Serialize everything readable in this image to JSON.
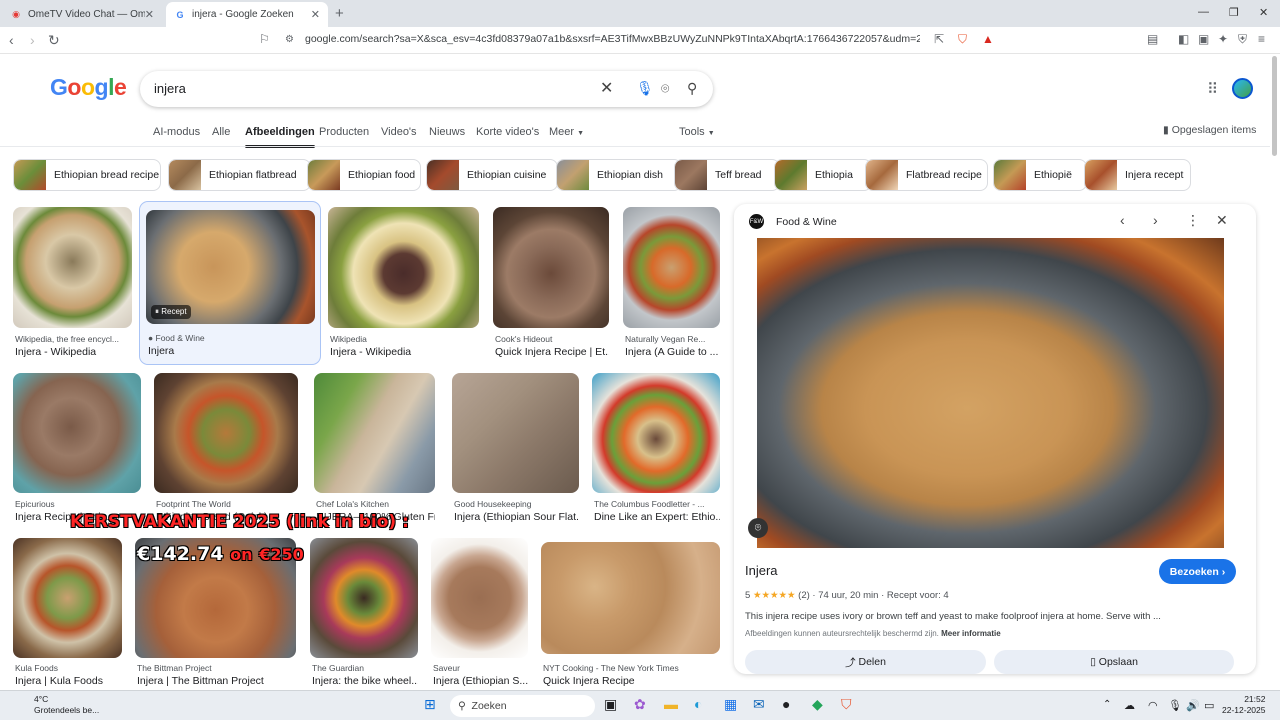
{
  "browser": {
    "tabs": [
      {
        "title": "OmeTV Video Chat — Omegle R",
        "active": false
      },
      {
        "title": "injera - Google Zoeken",
        "active": true
      }
    ],
    "url": "google.com/search?sa=X&sca_esv=4c3fd08379a07a1b&sxsrf=AE3TifMwxBBzUWyZuNNPk9TIntaXAbqrtA:1766436722057&udm=2&fbs=AIIjpHzoN..."
  },
  "google": {
    "logo": "Google",
    "query": "injera",
    "tabs": [
      "AI-modus",
      "Alle",
      "Afbeeldingen",
      "Producten",
      "Video's",
      "Nieuws",
      "Korte video's",
      "Meer",
      "Tools"
    ],
    "selected_tab": "Afbeeldingen",
    "saved_label": "Opgeslagen items"
  },
  "chips": [
    "Ethiopian bread recipe",
    "Ethiopian flatbread",
    "Ethiopian food",
    "Ethiopian cuisine",
    "Ethiopian dish",
    "Teff bread",
    "Ethiopia",
    "Flatbread recipe",
    "Ethiopië",
    "Injera recept"
  ],
  "results": [
    {
      "source": "Wikipedia, the free encycl...",
      "caption": "Injera - Wikipedia",
      "badge": ""
    },
    {
      "source": "Food & Wine",
      "caption": "Injera",
      "badge": "Recept"
    },
    {
      "source": "Wikipedia",
      "caption": "Injera - Wikipedia",
      "badge": ""
    },
    {
      "source": "Cook's Hideout",
      "caption": "Quick Injera Recipe | Et...",
      "badge": ""
    },
    {
      "source": "Naturally Vegan Re...",
      "caption": "Injera (A Guide to ...",
      "badge": ""
    },
    {
      "source": "Epicurious",
      "caption": "Injera Recipe | Epi...",
      "badge": ""
    },
    {
      "source": "Footprint The World",
      "caption": "Ethiopian Bread (Quick)",
      "badge": ""
    },
    {
      "source": "Chef Lola's Kitchen",
      "caption": "INJERA—100% Gluten Fr...",
      "badge": ""
    },
    {
      "source": "Good Housekeeping",
      "caption": "Injera (Ethiopian Sour Flat...",
      "badge": ""
    },
    {
      "source": "The Columbus Foodletter - ...",
      "caption": "Dine Like an Expert: Ethio...",
      "badge": ""
    },
    {
      "source": "Kula Foods",
      "caption": "Injera | Kula Foods",
      "badge": ""
    },
    {
      "source": "The Bittman Project",
      "caption": "Injera | The Bittman Project",
      "badge": ""
    },
    {
      "source": "The Guardian",
      "caption": "Injera: the bike wheel...",
      "badge": ""
    },
    {
      "source": "Saveur",
      "caption": "Injera (Ethiopian S...",
      "badge": ""
    },
    {
      "source": "NYT Cooking - The New York Times",
      "caption": "Quick Injera Recipe",
      "badge": ""
    }
  ],
  "overlays": {
    "promo_line": "KERSTVAKANTIE 2025 (link in bio) :",
    "price": "€142.74",
    "on_word": "on",
    "old_price": "€250"
  },
  "panel": {
    "source": "Food & Wine",
    "title": "Injera",
    "visit_label": "Bezoeken",
    "rating": "5",
    "stars": "★★★★★",
    "reviews": "(2)",
    "duration": "74 uur, 20 min",
    "serves": "Recept voor: 4",
    "description": "This injera recipe uses ivory or brown teff and yeast to make foolproof injera at home. Serve with ...",
    "copyright": "Afbeeldingen kunnen auteursrechtelijk beschermd zijn.",
    "more_info": "Meer informatie",
    "share_label": "Delen",
    "save_label": "Opslaan"
  },
  "taskbar": {
    "temp": "4°C",
    "weather": "Grotendeels be...",
    "search_label": "Zoeken",
    "time": "21:52",
    "date": "22-12-2025"
  }
}
